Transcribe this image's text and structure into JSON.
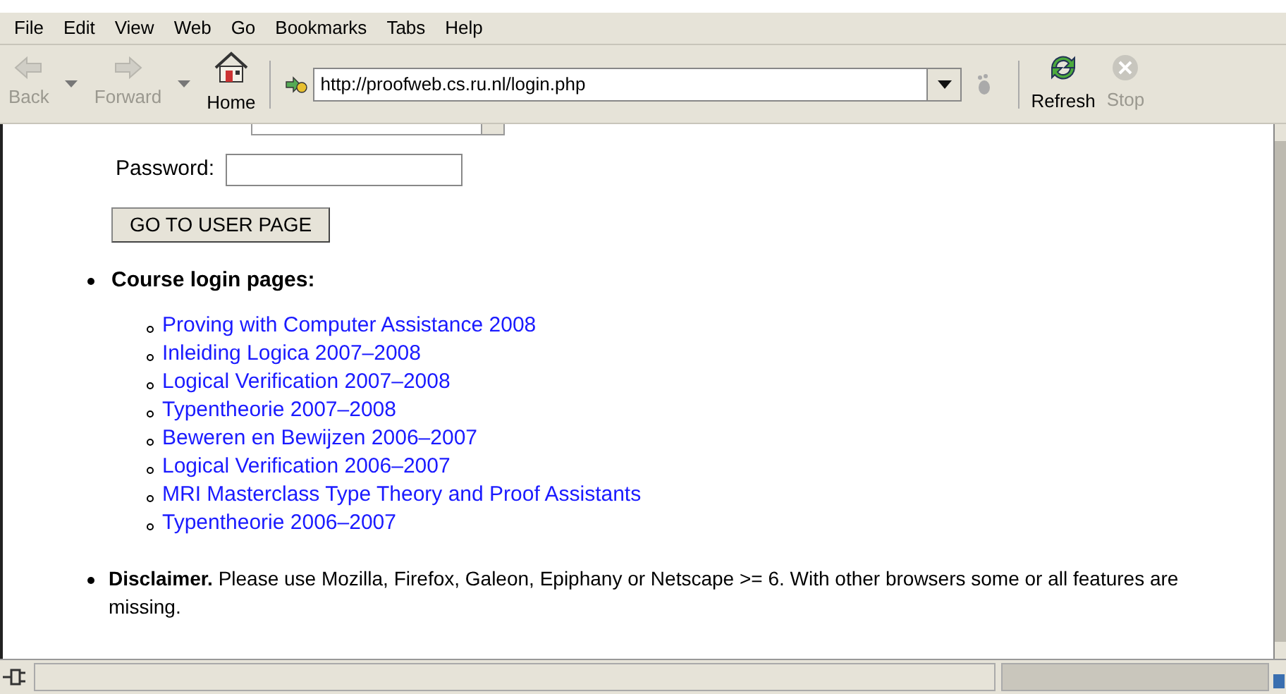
{
  "menu_bar": [
    "File",
    "Edit",
    "View",
    "Web",
    "Go",
    "Bookmarks",
    "Tabs",
    "Help"
  ],
  "toolbar": [
    {
      "kind": "back",
      "label": "Back",
      "disabled": true
    },
    {
      "kind": "history"
    },
    {
      "kind": "forward",
      "label": "Forward",
      "disabled": true
    },
    {
      "kind": "history"
    },
    {
      "kind": "home",
      "label": "Home",
      "disabled": false
    }
  ],
  "location": {
    "value": "http://proofweb.cs.ru.nl/login.php"
  },
  "toolbar_right": [
    {
      "kind": "refresh",
      "label": "Refresh",
      "disabled": false
    },
    {
      "kind": "stop",
      "label": "Stop",
      "disabled": true
    }
  ],
  "login_form": {
    "password_label": "Password:",
    "submit": "GO TO USER PAGE"
  },
  "course_section": {
    "heading": "Course login pages:",
    "links": [
      "Proving with Computer Assistance 2008",
      "Inleiding Logica 2007–2008",
      "Logical Verification 2007–2008",
      "Typentheorie 2007–2008",
      "Beweren en Bewijzen 2006–2007",
      "Logical Verification 2006–2007",
      "MRI Masterclass Type Theory and Proof Assistants",
      "Typentheorie 2006–2007"
    ]
  },
  "disclaimer": "**Disclaimer.** Please use Mozilla, Firefox, Galeon, Epiphany or Netscape >= 6. With other browsers some or all features are missing."
}
